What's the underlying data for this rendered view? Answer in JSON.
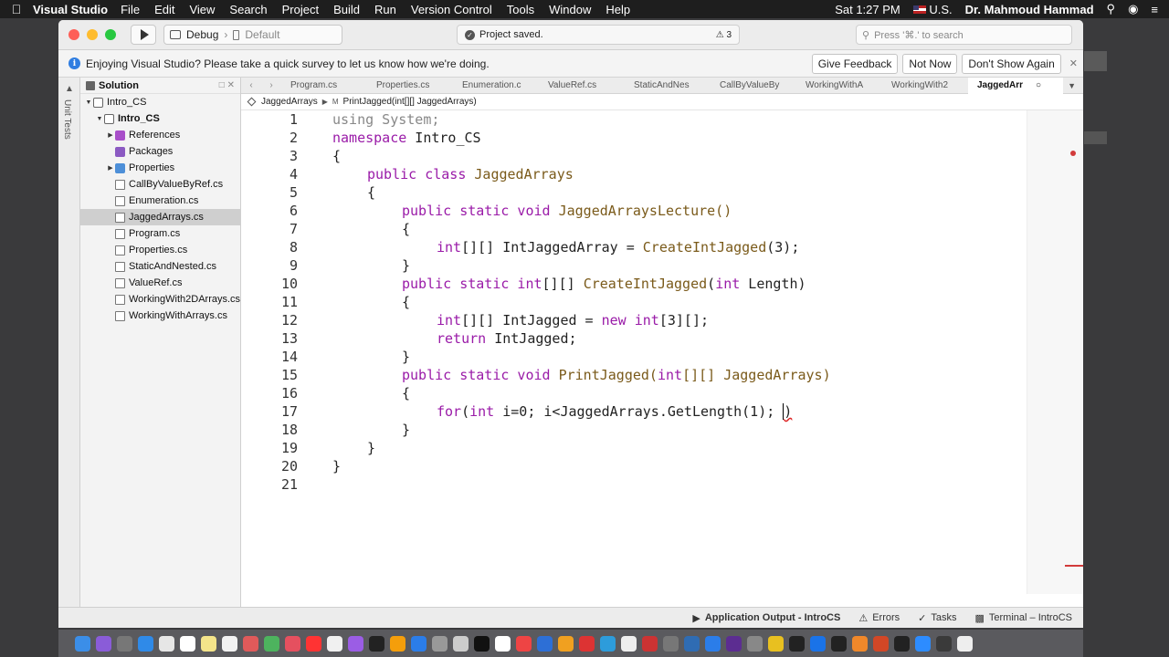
{
  "menubar": {
    "app": "Visual Studio",
    "items": [
      "File",
      "Edit",
      "View",
      "Search",
      "Project",
      "Build",
      "Run",
      "Version Control",
      "Tools",
      "Window",
      "Help"
    ],
    "clock": "Sat 1:27 PM",
    "input_source": "U.S.",
    "user": "Dr. Mahmoud Hammad"
  },
  "toolbar": {
    "config": "Debug",
    "target": "Default",
    "status": "Project saved.",
    "warnings": "3",
    "search_placeholder": "Press '⌘.' to search"
  },
  "infobar": {
    "message": "Enjoying Visual Studio? Please take a quick survey to let us know how we're doing.",
    "give_feedback": "Give Feedback",
    "not_now": "Not Now",
    "dont_show": "Don't Show Again"
  },
  "side_tab": {
    "label": "Unit Tests"
  },
  "solution": {
    "title": "Solution",
    "root": "Intro_CS",
    "project": "Intro_CS",
    "items": [
      {
        "label": "References",
        "icon": "references-icon"
      },
      {
        "label": "Packages",
        "icon": "packages-icon"
      },
      {
        "label": "Properties",
        "icon": "folder-icon"
      },
      {
        "label": "CallByValueByRef.cs",
        "icon": "cs-file-icon"
      },
      {
        "label": "Enumeration.cs",
        "icon": "cs-file-icon"
      },
      {
        "label": "JaggedArrays.cs",
        "icon": "cs-file-icon"
      },
      {
        "label": "Program.cs",
        "icon": "cs-file-icon"
      },
      {
        "label": "Properties.cs",
        "icon": "cs-file-icon"
      },
      {
        "label": "StaticAndNested.cs",
        "icon": "cs-file-icon"
      },
      {
        "label": "ValueRef.cs",
        "icon": "cs-file-icon"
      },
      {
        "label": "WorkingWith2DArrays.cs",
        "icon": "cs-file-icon"
      },
      {
        "label": "WorkingWithArrays.cs",
        "icon": "cs-file-icon"
      }
    ]
  },
  "tabs": [
    "Program.cs",
    "Properties.cs",
    "Enumeration.c",
    "ValueRef.cs",
    "StaticAndNes",
    "CallByValueBy",
    "WorkingWithA",
    "WorkingWith2",
    "JaggedArr"
  ],
  "breadcrumb": {
    "class": "JaggedArrays",
    "method": "PrintJagged(int[][] JaggedArrays)"
  },
  "code": {
    "line_numbers": [
      "1",
      "2",
      "3",
      "4",
      "5",
      "6",
      "7",
      "8",
      "9",
      "10",
      "11",
      "12",
      "13",
      "14",
      "15",
      "16",
      "17",
      "18",
      "19",
      "20",
      "21"
    ],
    "l1a": "using",
    "l1b": " System;",
    "l2a": "namespace",
    "l2b": " Intro_CS",
    "l3": "{",
    "l4a": "public class",
    "l4b": " JaggedArrays",
    "l5": "{",
    "l6a": "public static void",
    "l6b": " JaggedArraysLecture()",
    "l7": "{",
    "l8a": "int",
    "l8b": "[][] IntJaggedArray = ",
    "l8c": "CreateIntJagged",
    "l8d": "(3);",
    "l9": "}",
    "l10a": "public static int",
    "l10b": "[][] ",
    "l10c": "CreateIntJagged",
    "l10d": "(",
    "l10e": "int",
    "l10f": " Length)",
    "l11": "{",
    "l12a": "int",
    "l12b": "[][] IntJagged = ",
    "l12c": "new int",
    "l12d": "[3][];",
    "l13a": "return",
    "l13b": " IntJagged;",
    "l14": "}",
    "l15a": "public static void",
    "l15b": " PrintJagged(",
    "l15c": "int",
    "l15d": "[][] JaggedArrays)",
    "l16": "{",
    "l17a": "for",
    "l17b": "(",
    "l17c": "int",
    "l17d": " i=0; i<JaggedArrays.GetLength(1); ",
    "l17e": ")",
    "l18": "}",
    "l19": "}",
    "l20": "}"
  },
  "bottom": {
    "output": "Application Output - IntroCS",
    "errors": "Errors",
    "tasks": "Tasks",
    "terminal": "Terminal – IntroCS"
  },
  "colors": {
    "keyword": "#9a1ba8",
    "type": "#7a5a1a",
    "selection": "#cfcfcf",
    "accent": "#2f7de1"
  }
}
